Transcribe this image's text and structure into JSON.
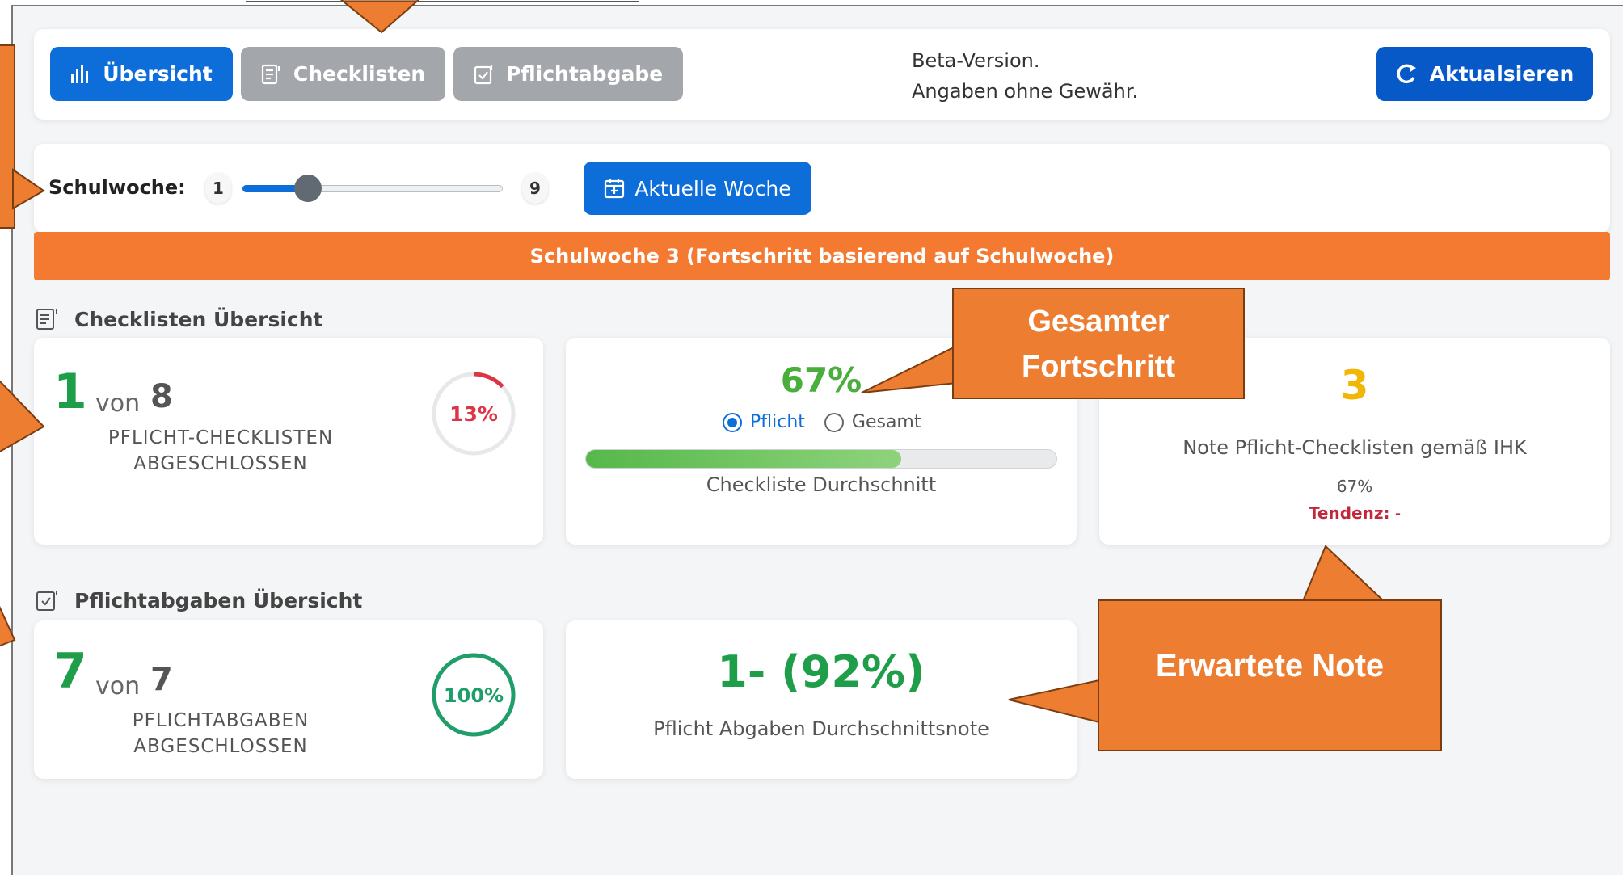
{
  "nav": {
    "overview_label": "Übersicht",
    "checklists_label": "Checklisten",
    "submissions_label": "Pflichtabgabe",
    "refresh_label": "Aktualsieren"
  },
  "beta": {
    "line1": "Beta-Version.",
    "line2": "Angaben ohne Gewähr."
  },
  "week_selector": {
    "label": "Schulwoche:",
    "min": "1",
    "max": "9",
    "value": 3,
    "current_week_button": "Aktuelle Woche"
  },
  "banner_text": "Schulwoche 3 (Fortschritt basierend auf Schulwoche)",
  "checklists": {
    "section_title": "Checklisten Übersicht",
    "completed": "1",
    "von": "von",
    "total": "8",
    "caption_line1": "PFLICHT-CHECKLISTEN",
    "caption_line2": "ABGESCHLOSSEN",
    "ring_percent_label": "13%",
    "ring_fraction": 0.13,
    "avg_percent": "67%",
    "avg_fraction": 0.67,
    "radio_pflicht": "Pflicht",
    "radio_gesamt": "Gesamt",
    "avg_caption": "Checkliste Durchschnitt",
    "grade": "3",
    "grade_caption": "Note Pflicht-Checklisten gemäß IHK",
    "grade_percent": "67%",
    "trend_label": "Tendenz:",
    "trend_value": " -"
  },
  "submissions": {
    "section_title": "Pflichtabgaben Übersicht",
    "completed": "7",
    "von": "von",
    "total": "7",
    "caption_line1": "PFLICHTABGABEN",
    "caption_line2": "ABGESCHLOSSEN",
    "ring_percent_label": "100%",
    "ring_fraction": 1.0,
    "avg_grade": "1- (92%)",
    "avg_caption": "Pflicht Abgaben Durchschnittsnote"
  },
  "callouts": {
    "total_progress_line1": "Gesamter",
    "total_progress_line2": "Fortschritt",
    "expected_grade": "Erwartete Note"
  },
  "colors": {
    "primary": "#0d6ed9",
    "banner": "#f47a32",
    "success": "#1f9e4a",
    "danger": "#dc3545",
    "warning": "#f2b705",
    "callout": "#ed7d31"
  }
}
